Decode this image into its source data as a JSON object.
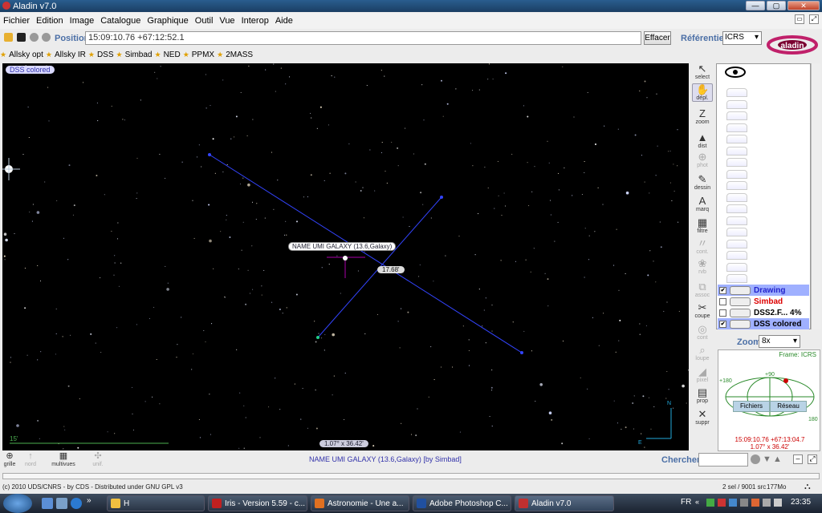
{
  "window": {
    "title": "Aladin v7.0"
  },
  "menu": [
    "Fichier",
    "Edition",
    "Image",
    "Catalogue",
    "Graphique",
    "Outil",
    "Vue",
    "Interop",
    "Aide"
  ],
  "toolbar": {
    "position_label": "Position",
    "position_value": "15:09:10.76 +67:12:52.1",
    "clear_label": "Effacer",
    "frame_label": "Référentiel",
    "frame_value": "ICRS"
  },
  "bookmarks": [
    "Allsky opt",
    "Allsky IR",
    "DSS",
    "Simbad",
    "NED",
    "PPMX",
    "2MASS"
  ],
  "viewer": {
    "survey_tag": "DSS colored",
    "object_label": "NAME UMI GALAXY (13.6,Galaxy)",
    "distance_label": "17.68'",
    "fov_label": "1.07° x 36.42'",
    "scale_label": "15'",
    "compass_n": "N",
    "compass_e": "E"
  },
  "tools": [
    {
      "label": "select",
      "glyph": "↖",
      "enabled": true
    },
    {
      "label": "dépl.",
      "glyph": "✋",
      "enabled": true
    },
    {
      "label": "zoom",
      "glyph": "Z",
      "enabled": true
    },
    {
      "label": "dist",
      "glyph": "▲",
      "enabled": true
    },
    {
      "label": "phot",
      "glyph": "⊕",
      "enabled": false
    },
    {
      "label": "dessin",
      "glyph": "✎",
      "enabled": true
    },
    {
      "label": "marq",
      "glyph": "A",
      "enabled": true
    },
    {
      "label": "filtre",
      "glyph": "▦",
      "enabled": true
    },
    {
      "label": "cont.",
      "glyph": "〃",
      "enabled": false
    },
    {
      "label": "rvb",
      "glyph": "❀",
      "enabled": false
    },
    {
      "label": "assoc",
      "glyph": "⧉",
      "enabled": false
    },
    {
      "label": "coupe",
      "glyph": "✂",
      "enabled": true
    },
    {
      "label": "cont",
      "glyph": "◎",
      "enabled": false
    },
    {
      "label": "loupe",
      "glyph": "⌕",
      "enabled": false
    },
    {
      "label": "pixel",
      "glyph": "◢",
      "enabled": false
    },
    {
      "label": "prop",
      "glyph": "▤",
      "enabled": true
    },
    {
      "label": "suppr",
      "glyph": "✕",
      "enabled": true
    }
  ],
  "planes": [
    {
      "name": "Drawing",
      "color": "#2222cc",
      "checked": true,
      "selected": true
    },
    {
      "name": "Simbad",
      "color": "#dd0000",
      "checked": false,
      "selected": false
    },
    {
      "name": "DSS2.F... 4%",
      "color": "#000000",
      "checked": false,
      "selected": false
    },
    {
      "name": "DSS colored",
      "color": "#000000",
      "checked": true,
      "selected": true
    }
  ],
  "zoom": {
    "label": "Zoom",
    "value": "8x"
  },
  "frame_panel": {
    "title": "Frame: ICRS",
    "coords": "15:09:10.76 +67:13:04.7",
    "fov": "1.07° x 36.42'",
    "plus90": "+90",
    "plus180": "+180",
    "minus180": "180",
    "btn_files": "Fichiers",
    "btn_network": "Réseau"
  },
  "bottom_tools": [
    {
      "label": "grille",
      "glyph": "⊕",
      "enabled": true
    },
    {
      "label": "nord",
      "glyph": "↑",
      "enabled": false
    },
    {
      "label": "multivues",
      "glyph": "▦",
      "enabled": true
    },
    {
      "label": "unif.",
      "glyph": "✣",
      "enabled": false
    }
  ],
  "status": {
    "text": "NAME UMI GALAXY (13.6,Galaxy)    [by Simbad]"
  },
  "search": {
    "label": "Chercher"
  },
  "footer": {
    "copyright": "(c) 2010 UDS/CNRS - by CDS - Distributed under GNU GPL v3",
    "selection": "2 sel / 9001 src",
    "memory": "177Mo"
  },
  "taskbar": {
    "tasks": [
      {
        "label": "H",
        "color": "#f0c040"
      },
      {
        "label": "Iris - Version 5.59 - c...",
        "color": "#c02020"
      },
      {
        "label": "Astronomie - Une a...",
        "color": "#e07020"
      },
      {
        "label": "Adobe Photoshop C...",
        "color": "#2050a0"
      },
      {
        "label": "Aladin v7.0",
        "color": "#c03030"
      }
    ],
    "lang": "FR",
    "clock": "23:35"
  }
}
